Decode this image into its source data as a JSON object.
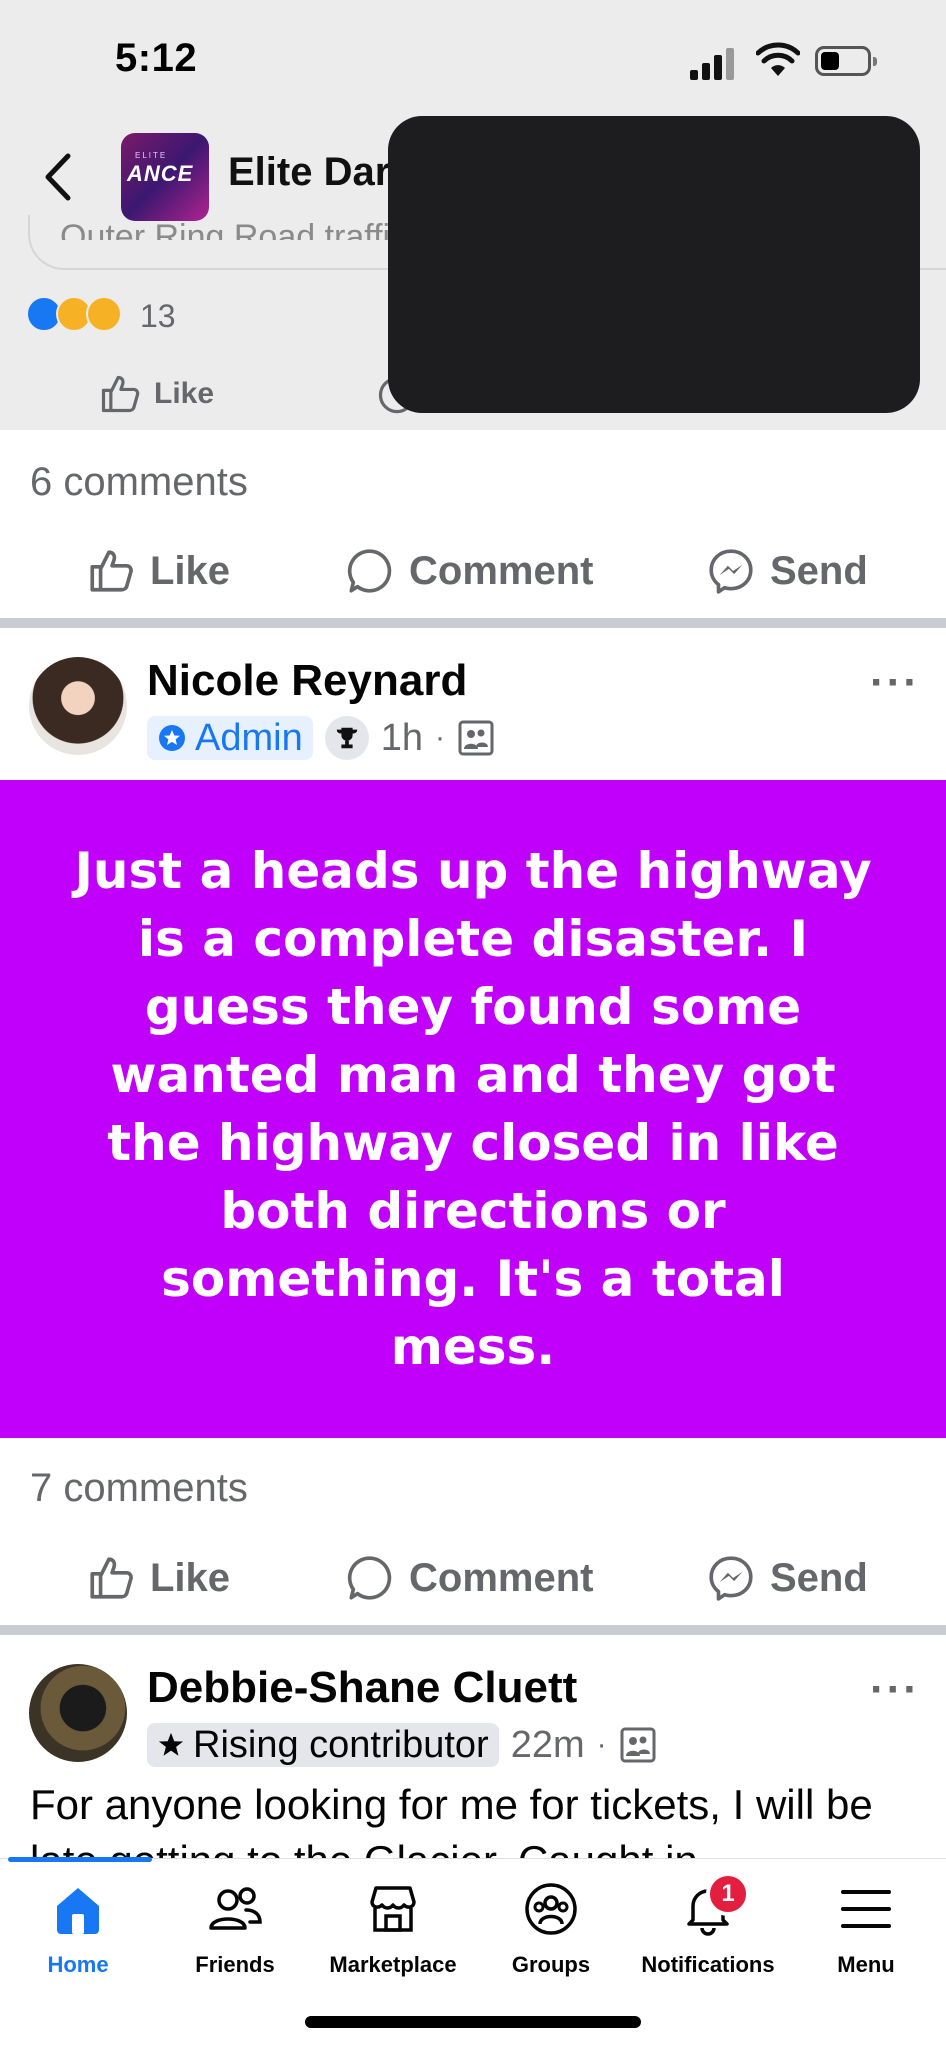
{
  "status_bar": {
    "time": "5:12"
  },
  "group_header": {
    "name": "Elite Dar",
    "logo_text": "ANCE",
    "logo_small": "ELITE"
  },
  "previous_post": {
    "comment_placeholder_fragment": "Outer Ring Road traffi",
    "reaction_count": "13",
    "dim_like_label": "Like",
    "comments_label": "6 comments",
    "actions": {
      "like": "Like",
      "comment": "Comment",
      "send": "Send"
    }
  },
  "post1": {
    "author": "Nicole Reynard",
    "badge": "Admin",
    "time": "1h",
    "text": "Just a heads up the highway is a complete disaster. I guess they found some wanted man and they got the highway closed in like both directions or something. It's a total mess.",
    "card_color": "#c000fa",
    "comments_label": "7 comments",
    "actions": {
      "like": "Like",
      "comment": "Comment",
      "send": "Send"
    }
  },
  "post2": {
    "author": "Debbie-Shane Cluett",
    "badge": "Rising contributor",
    "time": "22m",
    "text": "For anyone looking for me for tickets, I will be late getting to the Glacier. Caught in"
  },
  "nav": {
    "items": [
      {
        "label": "Home",
        "icon": "home-icon",
        "active": true
      },
      {
        "label": "Friends",
        "icon": "friends-icon"
      },
      {
        "label": "Marketplace",
        "icon": "marketplace-icon"
      },
      {
        "label": "Groups",
        "icon": "groups-icon"
      },
      {
        "label": "Notifications",
        "icon": "bell-icon",
        "badge": "1"
      },
      {
        "label": "Menu",
        "icon": "menu-icon"
      }
    ]
  },
  "colors": {
    "accent": "#1877f2",
    "muted": "#65676b",
    "notification": "#e41e3f"
  }
}
